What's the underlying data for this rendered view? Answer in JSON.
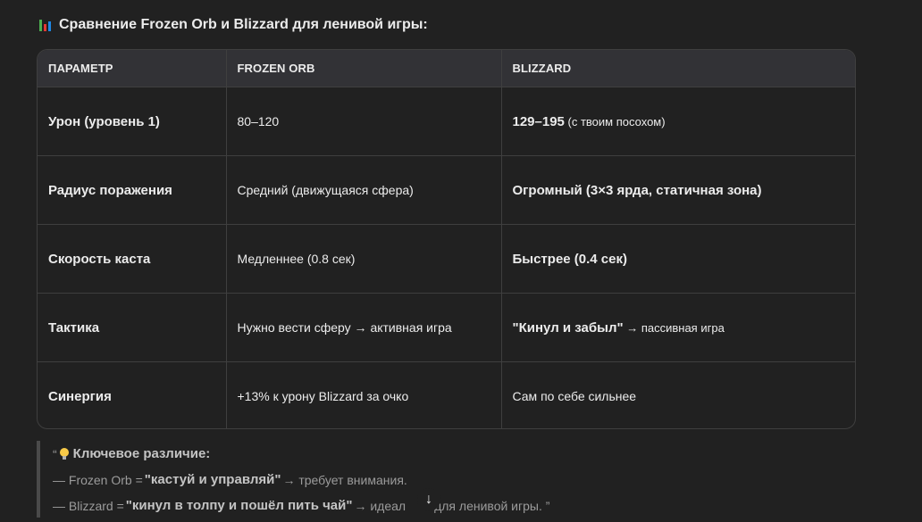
{
  "heading": "Сравнение Frozen Orb и Blizzard для ленивой игры:",
  "chart_icon_colors": [
    "#4caf50",
    "#e53935",
    "#1e88e5"
  ],
  "table": {
    "headers": [
      "ПАРАМЕТР",
      "FROZEN ORB",
      "BLIZZARD"
    ],
    "rows": [
      {
        "param": "Урон (уровень 1)",
        "frozen": "80–120",
        "blizzard_bold": "129–195",
        "blizzard_rest": " (с твоим посохом)"
      },
      {
        "param": "Радиус поражения",
        "frozen": "Средний (движущаяся сфера)",
        "blizzard_bold": "Огромный (3×3 ярда, статичная зона)",
        "blizzard_rest": ""
      },
      {
        "param": "Скорость каста",
        "frozen": "Медленнее (0.8 сек)",
        "blizzard_bold": "Быстрее (0.4 сек)",
        "blizzard_rest": ""
      },
      {
        "param": "Тактика",
        "frozen": "Нужно вести сферу → активная игра",
        "blizzard_bold": "\"Кинул и забыл\"",
        "blizzard_rest": " → пассивная игра"
      },
      {
        "param": "Синергия",
        "frozen": "+13% к урону Blizzard за очко",
        "blizzard_bold": "",
        "blizzard_rest": "Сам по себе сильнее"
      }
    ]
  },
  "quote": {
    "open": "“",
    "title": "Ключевое различие:",
    "line1_pre": "— Frozen Orb = ",
    "line1_bold": "\"кастуй и управляй\"",
    "line1_post": " → требует внимания.",
    "line2_pre": "— Blizzard = ",
    "line2_bold": "\"кинул в толпу и пошёл пить чай\"",
    "line2_post_a": " → идеал",
    "line2_post_b": "для ленивой игры. ”"
  },
  "scroll_arrow": "↓"
}
